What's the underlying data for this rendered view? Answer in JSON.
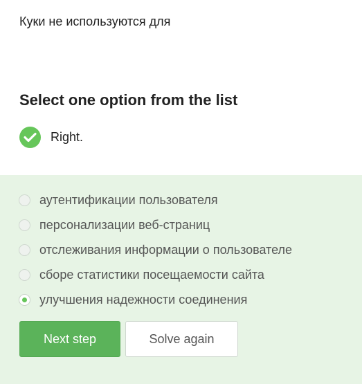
{
  "question": {
    "text": "Куки не используются для"
  },
  "section": {
    "heading": "Select one option from the list"
  },
  "result": {
    "label": "Right.",
    "icon": "checkmark-icon",
    "color": "#66c65a"
  },
  "options": [
    {
      "label": "аутентификации пользователя",
      "selected": false
    },
    {
      "label": "персонализации веб-страниц",
      "selected": false
    },
    {
      "label": "отслеживания информации о пользователе",
      "selected": false
    },
    {
      "label": "сборе статистики посещаемости сайта",
      "selected": false
    },
    {
      "label": "улучшения надежности соединения",
      "selected": true
    }
  ],
  "actions": {
    "next_step_label": "Next step",
    "solve_again_label": "Solve again"
  },
  "colors": {
    "accent": "#5bb35a",
    "panel_background": "#e7f4e5"
  }
}
